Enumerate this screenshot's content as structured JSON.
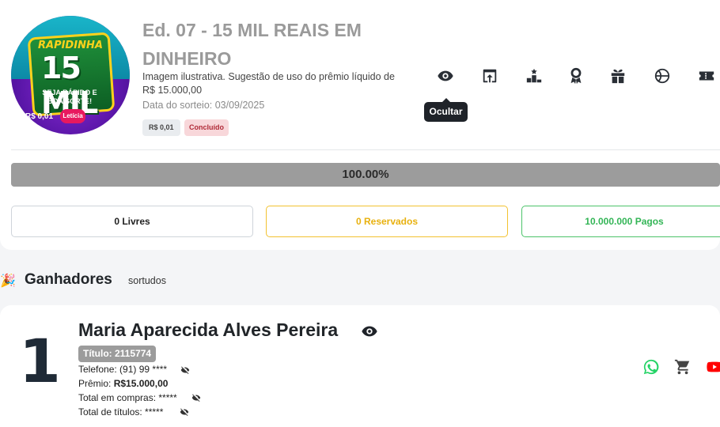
{
  "raffle": {
    "thumbnail": {
      "top_text": "RAPIDINHA",
      "de": "DE",
      "big_text": "15 MIL",
      "slogan": "SEJA RÁPIDO E BOA SORTE!",
      "price_text": "R$ 0,01",
      "brand": "Letícia"
    },
    "title": "Ed. 07 - 15 MIL REAIS EM DINHEIRO",
    "description": "Imagem ilustrativa. Sugestão de uso do prêmio líquido de R$ 15.000,00",
    "date": "Data do sorteio: 03/09/2025",
    "price_badge": "R$ 0,01",
    "status_badge": "Concluído"
  },
  "toolbar": {
    "icons": [
      "eye-icon",
      "open-external-icon",
      "podium-icon",
      "award-icon",
      "gift-icon",
      "basketball-icon",
      "ticket-icon"
    ],
    "tooltip": "Ocultar"
  },
  "progress": {
    "value": 100,
    "label": "100.00%",
    "fill_color": "#9c9c9c"
  },
  "stats": {
    "livres": "0 Livres",
    "reservados": "0 Reservados",
    "pagos": "10.000.000 Pagos"
  },
  "winners_section": {
    "title": "Ganhadores",
    "subtitle": "sortudos"
  },
  "winner": {
    "rank": "1",
    "name": "Maria Aparecida Alves Pereira",
    "ticket": "Título: 2115774",
    "phone_label": "Telefone:",
    "phone": "(91) 99 ****",
    "prize_label": "Prêmio:",
    "prize": "R$15.000,00",
    "purchases": "Total em compras: *****",
    "titles": "Total de títulos: *****",
    "actions": [
      "whatsapp-icon",
      "cart-icon",
      "youtube-icon"
    ]
  },
  "colors": {
    "livres_border": "#cfd4da",
    "reservados": "#f2c230",
    "pagos": "#4cc36a",
    "status_bg": "#f8d7da",
    "status_text": "#b02a37",
    "whatsapp": "#25d366",
    "youtube": "#ff0000"
  }
}
